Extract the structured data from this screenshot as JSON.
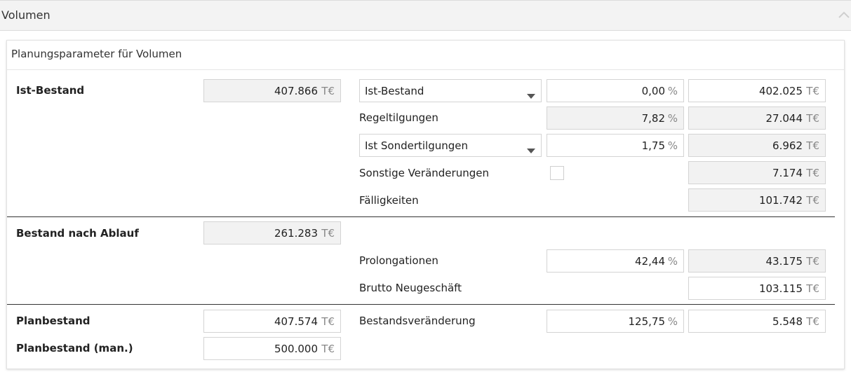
{
  "section": {
    "title": "Volumen",
    "collapse_icon": "chevron-up-icon"
  },
  "panel": {
    "title": "Planungsparameter für Volumen"
  },
  "unit_currency": "T€",
  "unit_percent": "%",
  "ist_bestand": {
    "label": "Ist-Bestand",
    "value": "407.866"
  },
  "dropdown_ist": {
    "selected": "Ist-Bestand",
    "percent": "0,00",
    "amount": "402.025"
  },
  "regeltilgungen": {
    "label": "Regeltilgungen",
    "percent": "7,82",
    "amount": "27.044"
  },
  "dropdown_sonder": {
    "selected": "Ist Sondertilgungen",
    "percent": "1,75",
    "amount": "6.962"
  },
  "sonstige": {
    "label": "Sonstige Veränderungen",
    "checked": false,
    "amount": "7.174"
  },
  "faelligkeiten": {
    "label": "Fälligkeiten",
    "amount": "101.742"
  },
  "bestand_nach_ablauf": {
    "label": "Bestand nach Ablauf",
    "value": "261.283"
  },
  "prolongationen": {
    "label": "Prolongationen",
    "percent": "42,44",
    "amount": "43.175"
  },
  "brutto_neugeschaeft": {
    "label": "Brutto Neugeschäft",
    "amount": "103.115"
  },
  "planbestand": {
    "label": "Planbestand",
    "value": "407.574"
  },
  "bestandsveraenderung": {
    "label": "Bestandsveränderung",
    "percent": "125,75",
    "amount": "5.548"
  },
  "planbestand_man": {
    "label": "Planbestand (man.)",
    "value": "500.000"
  }
}
